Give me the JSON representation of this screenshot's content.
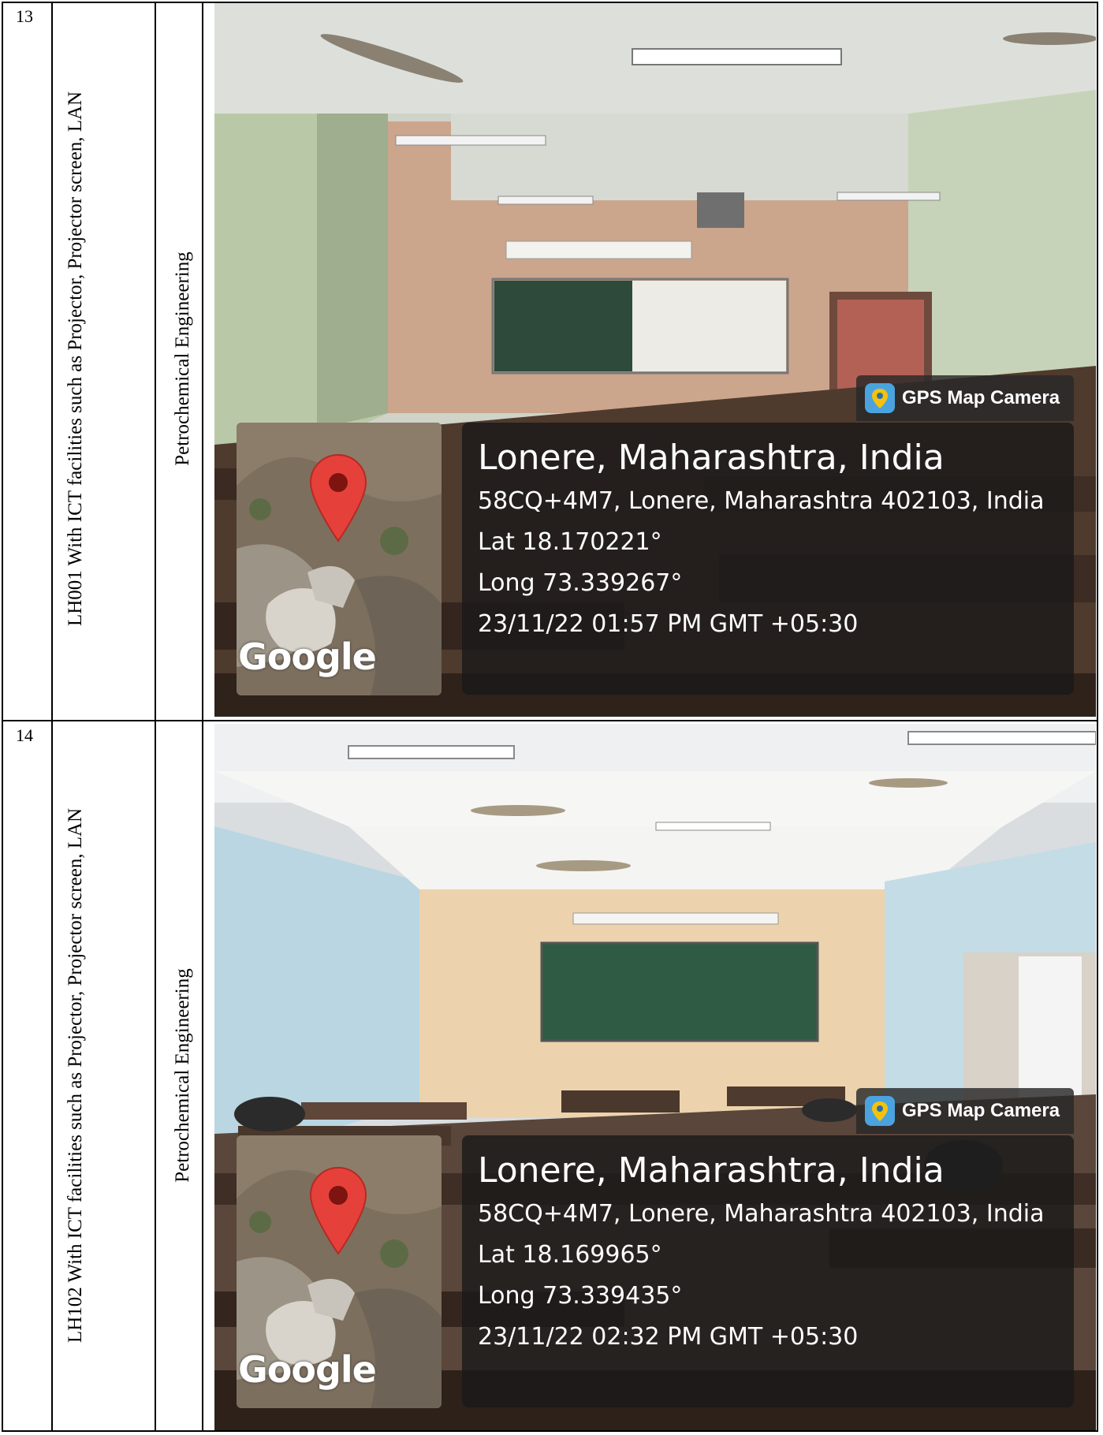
{
  "rows": [
    {
      "number": "13",
      "description": "LH001 With ICT facilities such as Projector, Projector screen, LAN",
      "department": "Petrochemical Engineering",
      "photo": {
        "badge": "GPS Map Camera",
        "city": "Lonere, Maharashtra, India",
        "address": "58CQ+4M7, Lonere, Maharashtra 402103, India",
        "lat": "Lat 18.170221°",
        "long": "Long 73.339267°",
        "datetime": "23/11/22 01:57 PM GMT +05:30",
        "map_logo": "Google"
      }
    },
    {
      "number": "14",
      "description": "LH102 With ICT facilities such as Projector, Projector screen, LAN",
      "department": "Petrochemical Engineering",
      "photo": {
        "badge": "GPS Map Camera",
        "city": "Lonere, Maharashtra, India",
        "address": "58CQ+4M7, Lonere, Maharashtra 402103, India",
        "lat": "Lat 18.169965°",
        "long": "Long 73.339435°",
        "datetime": "23/11/22 02:32 PM GMT +05:30",
        "map_logo": "Google"
      }
    }
  ],
  "icons": {
    "badge_icon": "gps-map-camera-icon",
    "map_pin": "location-pin-icon"
  },
  "colors": {
    "pin_red": "#e5413a",
    "overlay": "#1f1f1f"
  }
}
